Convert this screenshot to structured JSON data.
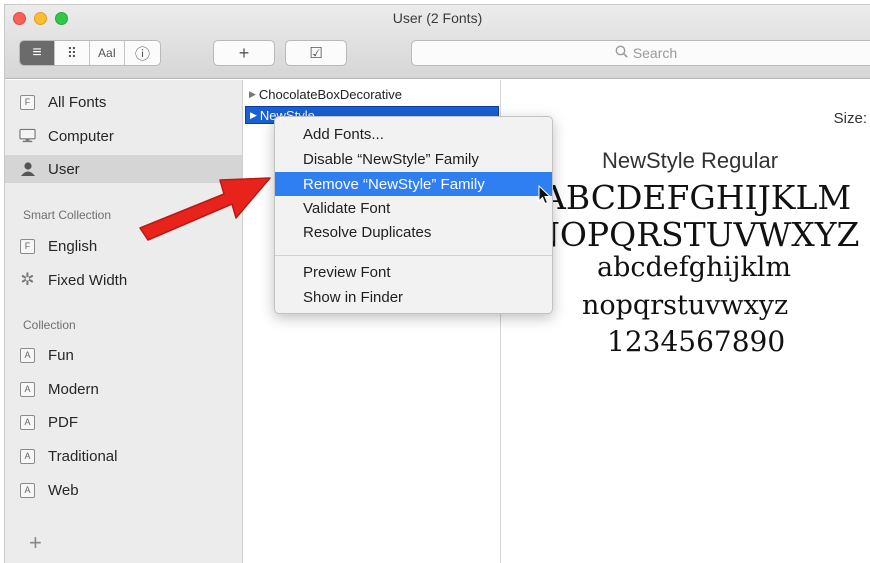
{
  "window": {
    "title": "User (2 Fonts)"
  },
  "toolbar": {
    "view_buttons": [
      {
        "icon": "list-icon",
        "glyph": "≡"
      },
      {
        "icon": "grid-icon",
        "glyph": "⠿"
      },
      {
        "icon": "sample-text-icon",
        "glyph": "AaI"
      },
      {
        "icon": "info-icon",
        "glyph": "ⓘ"
      }
    ],
    "add_glyph": "+",
    "validate_glyph": "☑",
    "search_placeholder": "Search"
  },
  "sidebar": {
    "top_items": [
      {
        "label": "All Fonts",
        "icon": "font-box-icon"
      },
      {
        "label": "Computer",
        "icon": "monitor-icon"
      },
      {
        "label": "User",
        "icon": "person-icon",
        "selected": true
      }
    ],
    "smart_header": "Smart Collection",
    "smart_items": [
      {
        "label": "English",
        "icon": "font-box-icon"
      },
      {
        "label": "Fixed Width",
        "icon": "gear-icon"
      }
    ],
    "collection_header": "Collection",
    "collection_items": [
      {
        "label": "Fun"
      },
      {
        "label": "Modern"
      },
      {
        "label": "PDF"
      },
      {
        "label": "Traditional"
      },
      {
        "label": "Web"
      }
    ],
    "add_glyph": "+"
  },
  "font_list": {
    "items": [
      {
        "label": "ChocolateBoxDecorative",
        "selected": false
      },
      {
        "label": "NewStyle",
        "selected": true
      }
    ]
  },
  "context_menu": {
    "group1": [
      "Add Fonts...",
      "Disable “NewStyle” Family",
      "Remove “NewStyle” Family",
      "Validate Font",
      "Resolve Duplicates"
    ],
    "highlighted": "Remove “NewStyle” Family",
    "group2": [
      "Preview Font",
      "Show in Finder"
    ]
  },
  "preview": {
    "size_label": "Size:",
    "font_name": "NewStyle Regular",
    "lines": [
      "ABCDEFGHIJKLM",
      "NOPQRSTUVWXYZ",
      "abcdefghijklm",
      "nopqrstuvwxyz",
      "1234567890"
    ]
  },
  "annotation": {
    "arrow_color": "#e8231c"
  }
}
